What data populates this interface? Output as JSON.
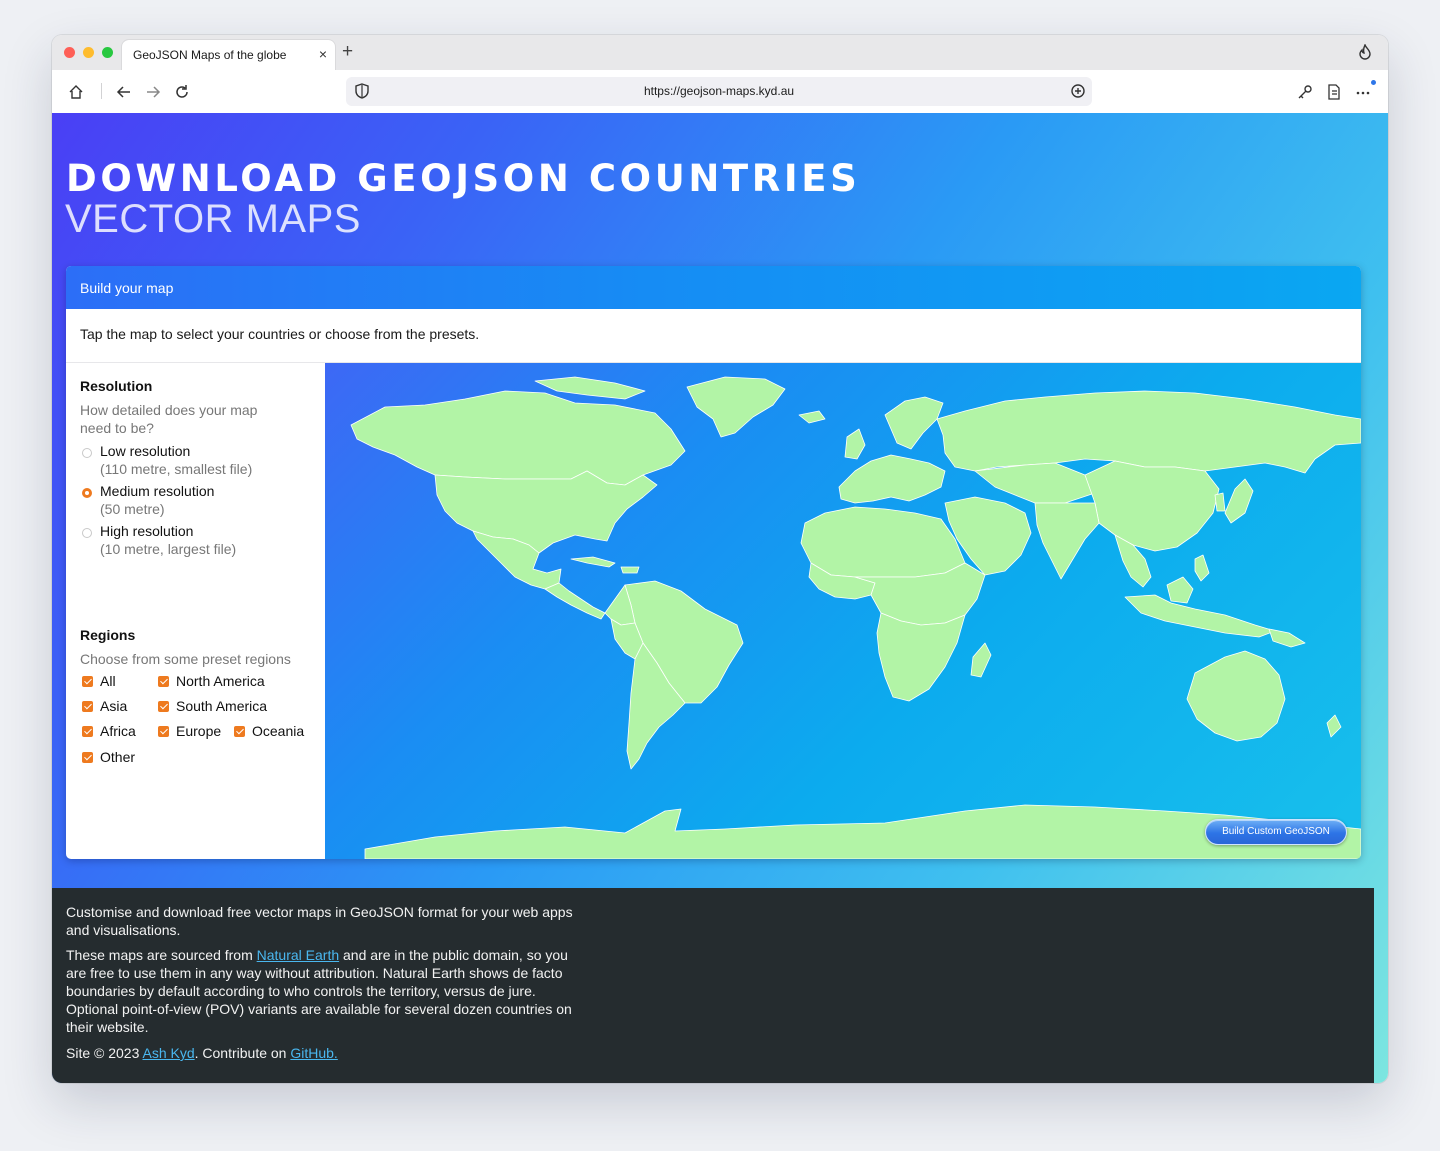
{
  "browser": {
    "tab_title": "GeoJSON Maps of the globe",
    "tab_close": "×",
    "new_tab": "+",
    "url": "https://geojson-maps.kyd.au"
  },
  "hero": {
    "title": "DOWNLOAD GEOJSON COUNTRIES",
    "subtitle": "VECTOR MAPS"
  },
  "card": {
    "header": "Build your map",
    "intro": "Tap the map to select your countries or choose from the presets."
  },
  "resolution": {
    "title": "Resolution",
    "description": "How detailed does your map need to be?",
    "options": [
      {
        "label": "Low resolution",
        "hint": "(110 metre, smallest file)",
        "selected": false
      },
      {
        "label": "Medium resolution",
        "hint": "(50 metre)",
        "selected": true
      },
      {
        "label": "High resolution",
        "hint": "(10 metre, largest file)",
        "selected": false
      }
    ]
  },
  "regions": {
    "title": "Regions",
    "description": "Choose from some preset regions",
    "options": [
      {
        "label": "All",
        "checked": true
      },
      {
        "label": "North America",
        "checked": true
      },
      {
        "label": "Asia",
        "checked": true
      },
      {
        "label": "South America",
        "checked": true
      },
      {
        "label": "Africa",
        "checked": true
      },
      {
        "label": "Europe",
        "checked": true
      },
      {
        "label": "Oceania",
        "checked": true
      },
      {
        "label": "Other",
        "checked": true
      }
    ]
  },
  "map": {
    "land_color": "#b2f4a6",
    "border_color": "#ffffff",
    "button_label": "Build Custom GeoJSON"
  },
  "footer": {
    "p1": "Customise and download free vector maps in GeoJSON format for your web apps and visualisations.",
    "p2_before": "These maps are sourced from ",
    "p2_link": "Natural Earth",
    "p2_after": " and are in the public domain, so you are free to use them in any way without attribution. Natural Earth shows de facto boundaries by default according to who controls the territory, versus de jure. Optional point-of-view (POV) variants are available for several dozen countries on their website.",
    "p3_before": "Site © 2023 ",
    "p3_link1": "Ash Kyd",
    "p3_middle": ". Contribute on ",
    "p3_link2": "GitHub."
  }
}
